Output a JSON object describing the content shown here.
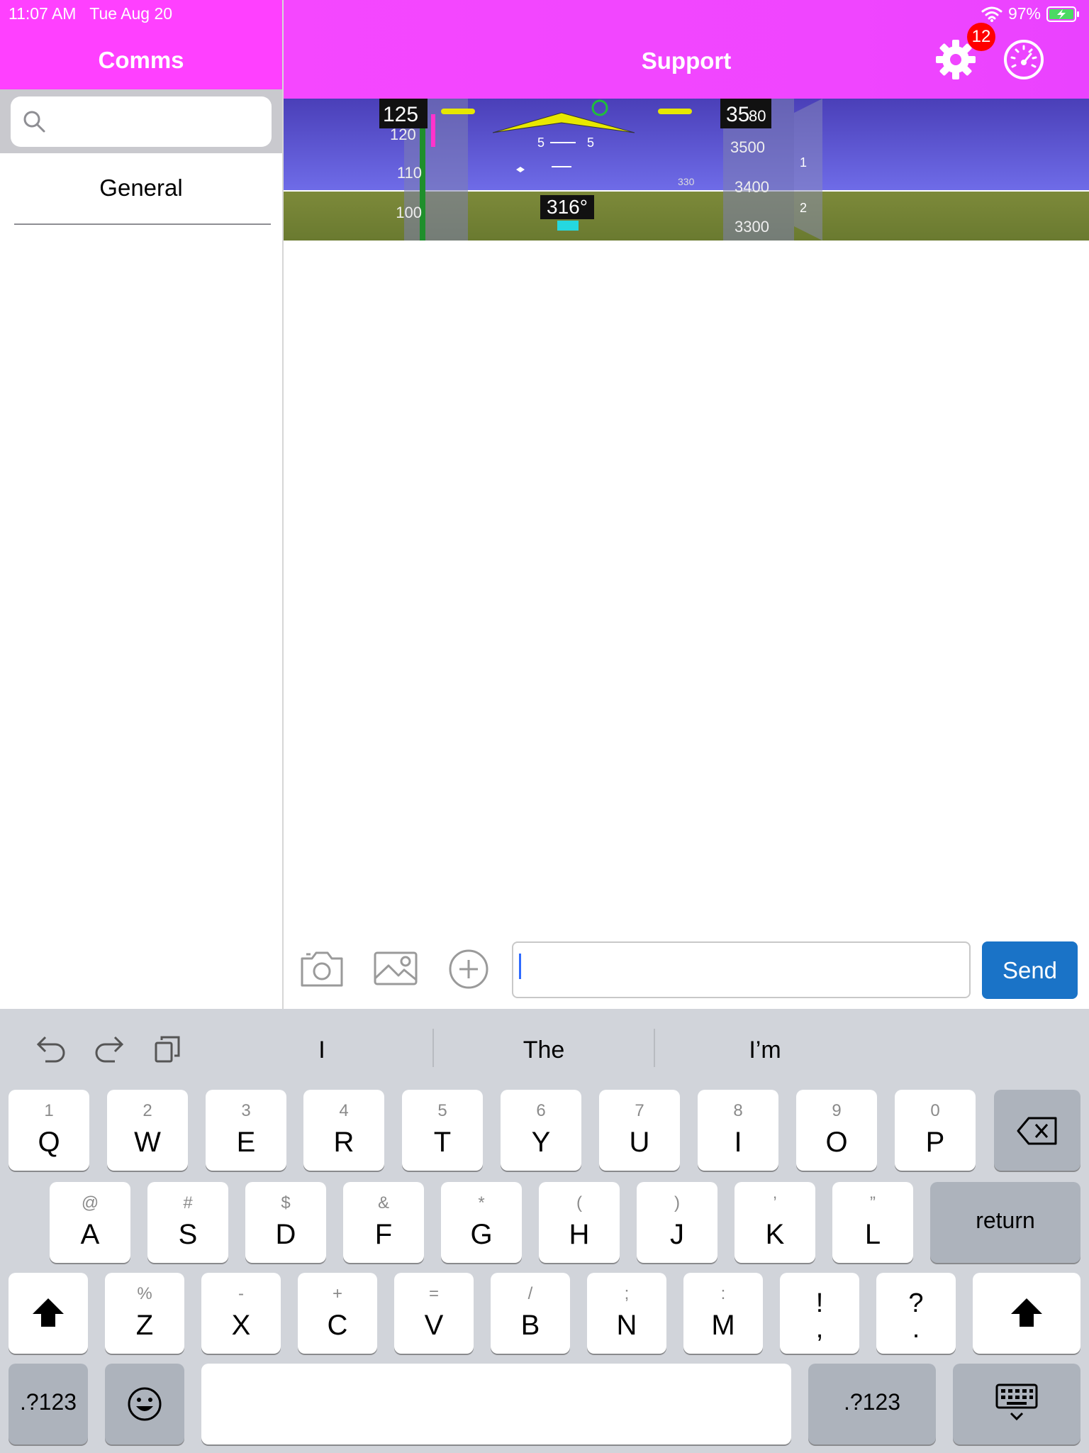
{
  "status_bar": {
    "time": "11:07 AM",
    "date": "Tue Aug 20",
    "battery": "97%",
    "wifi_icon": "wifi-icon",
    "battery_icon": "battery-charging-icon"
  },
  "left_pane": {
    "title": "Comms",
    "search": {
      "placeholder": "",
      "value": "",
      "icon": "search-icon"
    },
    "channels": [
      {
        "label": "General"
      }
    ]
  },
  "right_pane": {
    "title": "Support",
    "settings_badge": "12",
    "settings_icon": "gear-icon",
    "gauge_icon": "gauge-icon",
    "video_banner": {
      "speed_current": "125",
      "speed_tape": [
        "120",
        "110",
        "100"
      ],
      "altitude_current_major": "35",
      "altitude_current_minor": "80",
      "altitude_tape": [
        "3500",
        "3400",
        "3300"
      ],
      "vsi_marks": [
        "1",
        "2"
      ],
      "pitch_marks": [
        "5",
        "5"
      ],
      "heading": "316°",
      "heading_bug": "330"
    },
    "compose": {
      "camera_icon": "camera-icon",
      "gallery_icon": "photo-gallery-icon",
      "add_icon": "add-circle-icon",
      "message_value": "",
      "send_label": "Send"
    }
  },
  "keyboard": {
    "tools": [
      "undo-icon",
      "redo-icon",
      "clipboard-icon"
    ],
    "predictions": [
      "I",
      "The",
      "I’m"
    ],
    "row1": [
      {
        "hint": "1",
        "label": "Q"
      },
      {
        "hint": "2",
        "label": "W"
      },
      {
        "hint": "3",
        "label": "E"
      },
      {
        "hint": "4",
        "label": "R"
      },
      {
        "hint": "5",
        "label": "T"
      },
      {
        "hint": "6",
        "label": "Y"
      },
      {
        "hint": "7",
        "label": "U"
      },
      {
        "hint": "8",
        "label": "I"
      },
      {
        "hint": "9",
        "label": "O"
      },
      {
        "hint": "0",
        "label": "P"
      }
    ],
    "row2": [
      {
        "hint": "@",
        "label": "A"
      },
      {
        "hint": "#",
        "label": "S"
      },
      {
        "hint": "$",
        "label": "D"
      },
      {
        "hint": "&",
        "label": "F"
      },
      {
        "hint": "*",
        "label": "G"
      },
      {
        "hint": "(",
        "label": "H"
      },
      {
        "hint": ")",
        "label": "J"
      },
      {
        "hint": "’",
        "label": "K"
      },
      {
        "hint": "”",
        "label": "L"
      }
    ],
    "row3": [
      {
        "hint": "%",
        "label": "Z"
      },
      {
        "hint": "-",
        "label": "X"
      },
      {
        "hint": "+",
        "label": "C"
      },
      {
        "hint": "=",
        "label": "V"
      },
      {
        "hint": "/",
        "label": "B"
      },
      {
        "hint": ";",
        "label": "N"
      },
      {
        "hint": ":",
        "label": "M"
      },
      {
        "top": "!",
        "bottom": ","
      },
      {
        "top": "?",
        "bottom": "."
      }
    ],
    "return_label": "return",
    "numbers_label": ".?123",
    "numbers_label_right": ".?123",
    "emoji_icon": "emoji-icon",
    "hide_keyboard_icon": "keyboard-dismiss-icon",
    "shift_icon": "shift-icon",
    "delete_icon": "delete-icon"
  }
}
